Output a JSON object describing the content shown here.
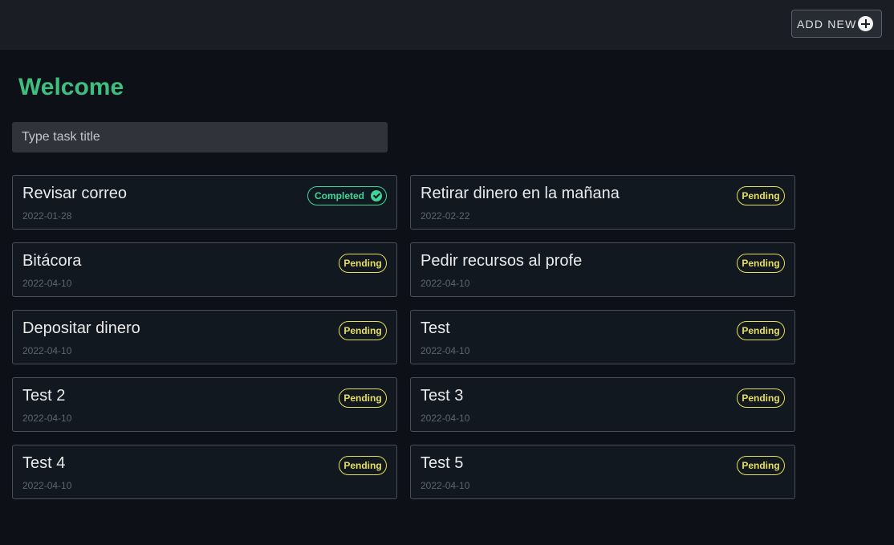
{
  "header": {
    "add_new_label": "ADD NEW"
  },
  "main": {
    "title": "Welcome",
    "search_placeholder": "Type task title"
  },
  "tasks": [
    {
      "title": "Revisar correo",
      "date": "2022-01-28",
      "status": "Completed"
    },
    {
      "title": "Retirar dinero en la mañana",
      "date": "2022-02-22",
      "status": "Pending"
    },
    {
      "title": "Bitácora",
      "date": "2022-04-10",
      "status": "Pending"
    },
    {
      "title": "Pedir recursos al profe",
      "date": "2022-04-10",
      "status": "Pending"
    },
    {
      "title": "Depositar dinero",
      "date": "2022-04-10",
      "status": "Pending"
    },
    {
      "title": "Test",
      "date": "2022-04-10",
      "status": "Pending"
    },
    {
      "title": "Test 2",
      "date": "2022-04-10",
      "status": "Pending"
    },
    {
      "title": "Test 3",
      "date": "2022-04-10",
      "status": "Pending"
    },
    {
      "title": "Test 4",
      "date": "2022-04-10",
      "status": "Pending"
    },
    {
      "title": "Test 5",
      "date": "2022-04-10",
      "status": "Pending"
    }
  ],
  "colors": {
    "accent": "#3fbf7f",
    "pending": "#e8df5c",
    "completed": "#3fd69a",
    "background": "#0d1117"
  }
}
